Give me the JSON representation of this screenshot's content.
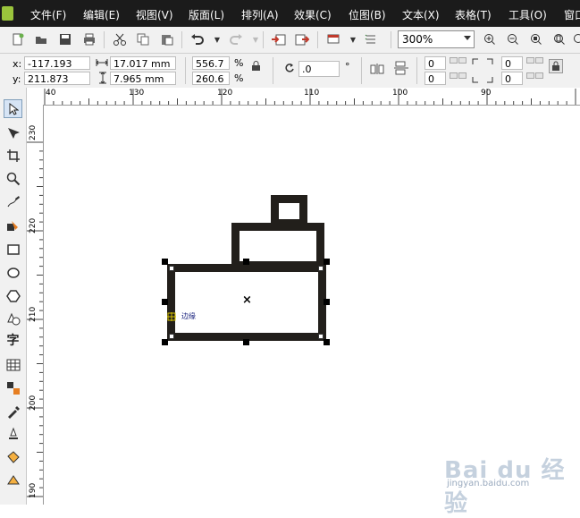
{
  "menu": [
    "文件(F)",
    "编辑(E)",
    "视图(V)",
    "版面(L)",
    "排列(A)",
    "效果(C)",
    "位图(B)",
    "文本(X)",
    "表格(T)",
    "工具(O)",
    "窗口"
  ],
  "toolbar": {
    "zoom": "300%",
    "icons": [
      "new-icon",
      "open-icon",
      "save-icon",
      "print-icon",
      "cut-icon",
      "copy-icon",
      "paste-icon",
      "undo-icon",
      "redo-icon",
      "import-icon",
      "export-icon",
      "app-launcher-icon",
      "welcome-icon",
      "zoom-in-icon",
      "zoom-out-icon",
      "zoom-selection-icon",
      "zoom-page-icon",
      "pan-icon"
    ]
  },
  "propbar": {
    "x_label": "x:",
    "x": "-117.193 mm",
    "y_label": "y:",
    "y": "211.873 mm",
    "width": "17.017 mm",
    "height": "7.965 mm",
    "scale_w": "556.7",
    "scale_h": "260.6",
    "pct": "%",
    "angle": ".0",
    "degree": "°",
    "nudge_1": "0",
    "nudge_2": "0",
    "nudge_3": "0",
    "nudge_4": "0"
  },
  "ruler": {
    "h_ticks": [
      "40",
      "130",
      "120",
      "110",
      "100",
      "90"
    ],
    "v_ticks": [
      "230",
      "220",
      "210",
      "200",
      "190"
    ]
  },
  "tools": [
    "pick-tool-icon",
    "shape-tool-icon",
    "crop-tool-icon",
    "zoom-tool-icon",
    "freehand-tool-icon",
    "smart-fill-tool-icon",
    "rectangle-tool-icon",
    "ellipse-tool-icon",
    "polygon-tool-icon",
    "basic-shapes-tool-icon",
    "text-tool-icon",
    "table-tool-icon",
    "interactive-blend-tool-icon",
    "eyedropper-tool-icon",
    "outline-tool-icon",
    "fill-tool-icon",
    "interactive-fill-tool-icon"
  ],
  "tool_text_glyph": "字",
  "canvas": {
    "snap_label": "边缘",
    "center_mark": "×",
    "shape_color": "#221f1b"
  },
  "watermark": {
    "logo": "Bai du 经验",
    "site": "jingyan.baidu.com"
  }
}
